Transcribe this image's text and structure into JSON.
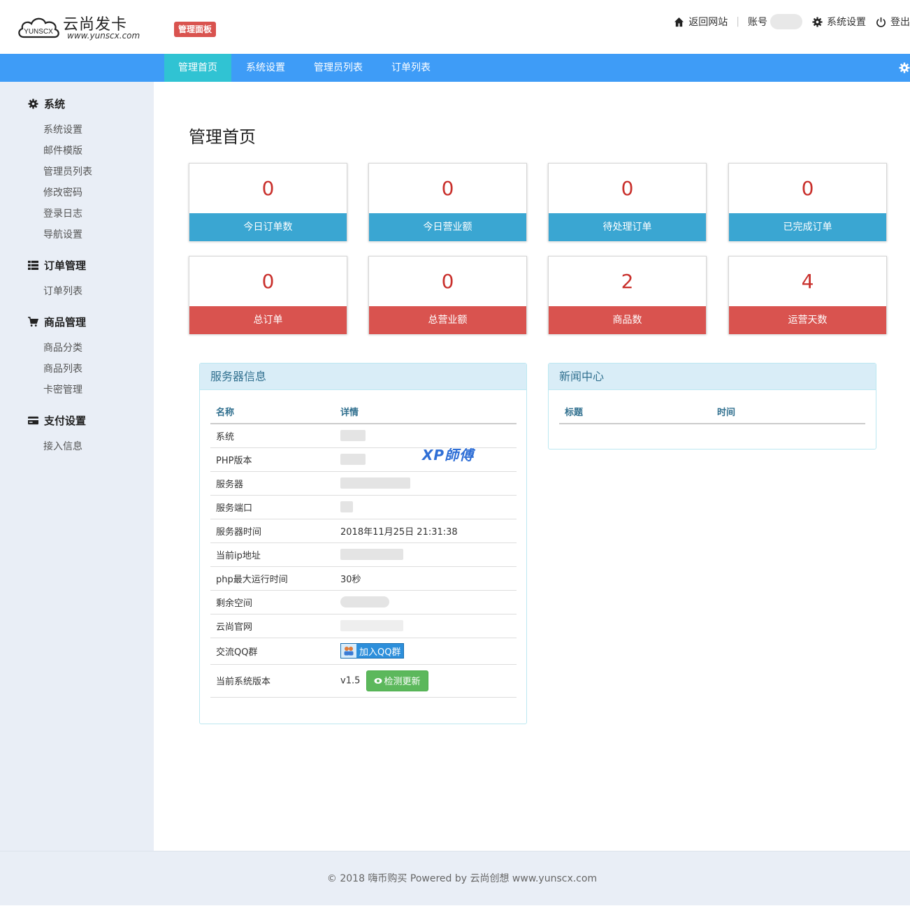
{
  "header": {
    "logo_text": "云尚发卡",
    "logo_badge": "YUNSCX",
    "logo_url": "www.yunscx.com",
    "admin_badge": "管理面板",
    "links": {
      "back_to_site": "返回网站",
      "account": "账号",
      "system_settings": "系统设置",
      "logout": "登出"
    }
  },
  "navbar": {
    "tabs": [
      "管理首页",
      "系统设置",
      "管理员列表",
      "订单列表"
    ],
    "active_tab": "管理首页"
  },
  "sidebar": {
    "groups": [
      {
        "title": "系统",
        "icon": "gear-icon",
        "items": [
          "系统设置",
          "邮件模版",
          "管理员列表",
          "修改密码",
          "登录日志",
          "导航设置"
        ]
      },
      {
        "title": "订单管理",
        "icon": "list-icon",
        "items": [
          "订单列表"
        ]
      },
      {
        "title": "商品管理",
        "icon": "cart-icon",
        "items": [
          "商品分类",
          "商品列表",
          "卡密管理"
        ]
      },
      {
        "title": "支付设置",
        "icon": "credit-card-icon",
        "items": [
          "接入信息"
        ]
      }
    ]
  },
  "main": {
    "title": "管理首页",
    "stats": [
      {
        "value": "0",
        "label": "今日订单数",
        "color": "#3aa6d2"
      },
      {
        "value": "0",
        "label": "今日营业额",
        "color": "#3aa6d2"
      },
      {
        "value": "0",
        "label": "待处理订单",
        "color": "#3aa6d2"
      },
      {
        "value": "0",
        "label": "已完成订单",
        "color": "#3aa6d2"
      },
      {
        "value": "0",
        "label": "总订单",
        "color": "#d9534f"
      },
      {
        "value": "0",
        "label": "总营业额",
        "color": "#d9534f"
      },
      {
        "value": "2",
        "label": "商品数",
        "color": "#d9534f"
      },
      {
        "value": "4",
        "label": "运营天数",
        "color": "#d9534f"
      }
    ],
    "server_panel": {
      "title": "服务器信息",
      "headers": [
        "名称",
        "详情"
      ],
      "rows": [
        {
          "name": "系统"
        },
        {
          "name": "PHP版本"
        },
        {
          "name": "服务器"
        },
        {
          "name": "服务端口"
        },
        {
          "name": "服务器时间",
          "value": "2018年11月25日 21:31:38"
        },
        {
          "name": "当前ip地址"
        },
        {
          "name": "php最大运行时间",
          "value": "30秒"
        },
        {
          "name": "剩余空间"
        },
        {
          "name": "云尚官网"
        },
        {
          "name": "交流QQ群",
          "button": "加入QQ群"
        },
        {
          "name": "当前系统版本",
          "value": "v1.5",
          "button": "检测更新"
        }
      ]
    },
    "news_panel": {
      "title": "新闻中心",
      "headers": [
        "标题",
        "时间"
      ]
    },
    "watermark": "XP師傅"
  },
  "footer": {
    "text": "© 2018  嗨币购买 Powered by 云尚创想 www.yunscx.com"
  }
}
